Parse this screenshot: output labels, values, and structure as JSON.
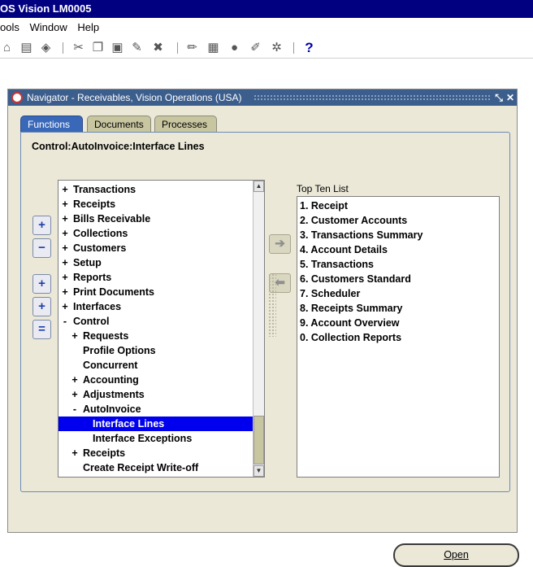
{
  "app": {
    "title": "OS Vision LM0005"
  },
  "menu": [
    "ools",
    "Window",
    "Help"
  ],
  "toolbar": {
    "icons": [
      "open-icon",
      "print-icon",
      "save-icon",
      "cut-icon",
      "copy-icon",
      "paste-icon",
      "clear-icon",
      "delete-icon",
      "edit-icon",
      "folder-icon",
      "record-icon",
      "attachment-icon",
      "zoom-icon"
    ],
    "help_label": "?"
  },
  "navigator": {
    "title": "Navigator - Receivables, Vision Operations (USA)",
    "tabs": [
      {
        "label": "Functions",
        "active": true
      },
      {
        "label": "Documents",
        "active": false
      },
      {
        "label": "Processes",
        "active": false
      }
    ],
    "breadcrumb": "Control:AutoInvoice:Interface Lines",
    "side_buttons": [
      "+",
      "−",
      "+",
      "+",
      "="
    ],
    "tree": [
      {
        "expander": "+",
        "label": "Transactions",
        "level": 0
      },
      {
        "expander": "+",
        "label": "Receipts",
        "level": 0
      },
      {
        "expander": "+",
        "label": "Bills Receivable",
        "level": 0
      },
      {
        "expander": "+",
        "label": "Collections",
        "level": 0
      },
      {
        "expander": "+",
        "label": "Customers",
        "level": 0
      },
      {
        "expander": "+",
        "label": "Setup",
        "level": 0
      },
      {
        "expander": "+",
        "label": "Reports",
        "level": 0
      },
      {
        "expander": "+",
        "label": "Print Documents",
        "level": 0
      },
      {
        "expander": "+",
        "label": "Interfaces",
        "level": 0
      },
      {
        "expander": "-",
        "label": "Control",
        "level": 0
      },
      {
        "expander": "+",
        "label": "Requests",
        "level": 1
      },
      {
        "expander": "",
        "label": "Profile Options",
        "level": 1
      },
      {
        "expander": "",
        "label": "Concurrent",
        "level": 1
      },
      {
        "expander": "+",
        "label": "Accounting",
        "level": 1
      },
      {
        "expander": "+",
        "label": "Adjustments",
        "level": 1
      },
      {
        "expander": "-",
        "label": "AutoInvoice",
        "level": 1
      },
      {
        "expander": "",
        "label": "Interface Lines",
        "level": 2,
        "selected": true
      },
      {
        "expander": "",
        "label": "Interface Exceptions",
        "level": 2
      },
      {
        "expander": "+",
        "label": "Receipts",
        "level": 1
      },
      {
        "expander": "",
        "label": "Create Receipt Write-off",
        "level": 1
      }
    ],
    "top_ten_label": "Top Ten List",
    "top_ten": [
      "1. Receipt",
      "2. Customer Accounts",
      "3. Transactions Summary",
      "4. Account Details",
      "5. Transactions",
      "6. Customers Standard",
      "7. Scheduler",
      "8. Receipts Summary",
      "9. Account Overview",
      "0. Collection Reports"
    ],
    "open_label": "Open"
  }
}
